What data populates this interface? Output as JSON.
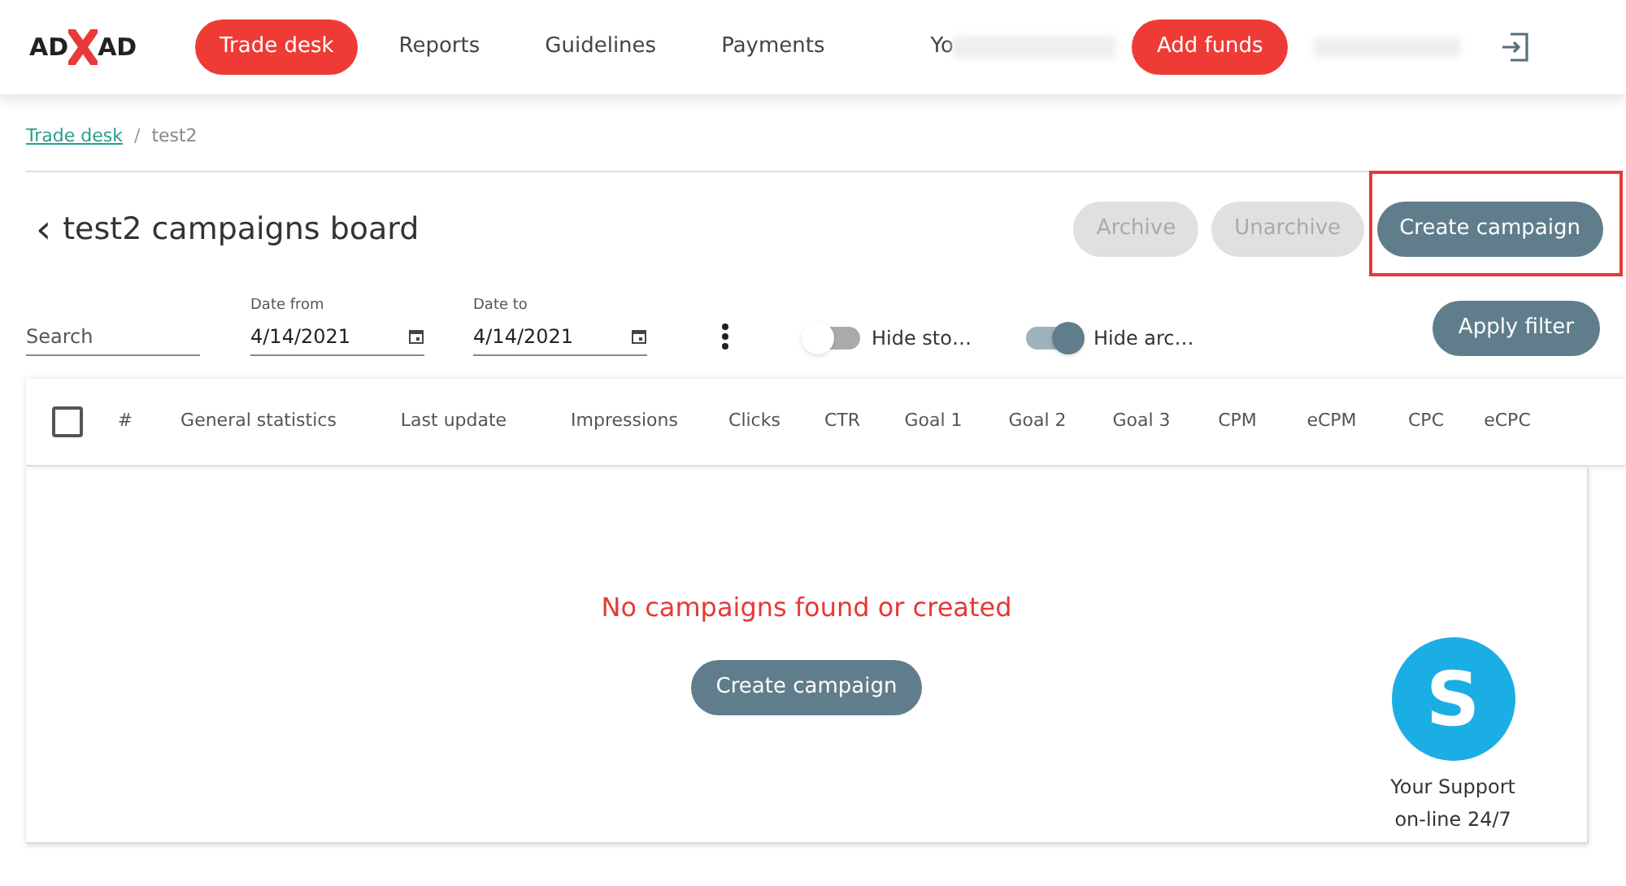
{
  "logo": {
    "left": "AD",
    "right": "AD"
  },
  "nav": [
    {
      "label": "Trade desk",
      "selected": true
    },
    {
      "label": "Reports",
      "selected": false
    },
    {
      "label": "Guidelines",
      "selected": false
    },
    {
      "label": "Payments",
      "selected": false
    }
  ],
  "balance_text": "Yo",
  "add_funds": "Add funds",
  "breadcrumb": [
    {
      "label": "Trade desk",
      "kind": "link"
    },
    {
      "label": "/",
      "kind": "separator"
    },
    {
      "label": "test2",
      "kind": "current"
    }
  ],
  "back_icon": "‹",
  "title": "test2 campaigns board",
  "actions": [
    {
      "label": "Archive",
      "disabled": true,
      "highlighted": false
    },
    {
      "label": "Unarchive",
      "disabled": true,
      "highlighted": false
    },
    {
      "label": "Create campaign",
      "disabled": false,
      "highlighted": true
    }
  ],
  "filters": {
    "search": {
      "placeholder": "Search"
    },
    "date_from": {
      "label": "Date from",
      "value": "4/14/2021"
    },
    "date_to": {
      "label": "Date to",
      "value": "4/14/2021"
    },
    "toggles": [
      {
        "label": "Hide sto…",
        "on": false
      },
      {
        "label": "Hide arc…",
        "on": true
      }
    ],
    "apply": "Apply filter"
  },
  "table": {
    "select_all": {
      "checked": false
    },
    "columns": [
      "#",
      "General statistics",
      "Last update",
      "Impressions",
      "Clicks",
      "CTR",
      "Goal 1",
      "Goal 2",
      "Goal 3",
      "CPM",
      "eCPM",
      "CPC",
      "eCPC"
    ],
    "empty_message": "No campaigns found or created",
    "create_button": "Create campaign"
  },
  "support": {
    "icon_letter": "S",
    "lines": [
      "Your Support",
      "on-line 24/7"
    ]
  }
}
